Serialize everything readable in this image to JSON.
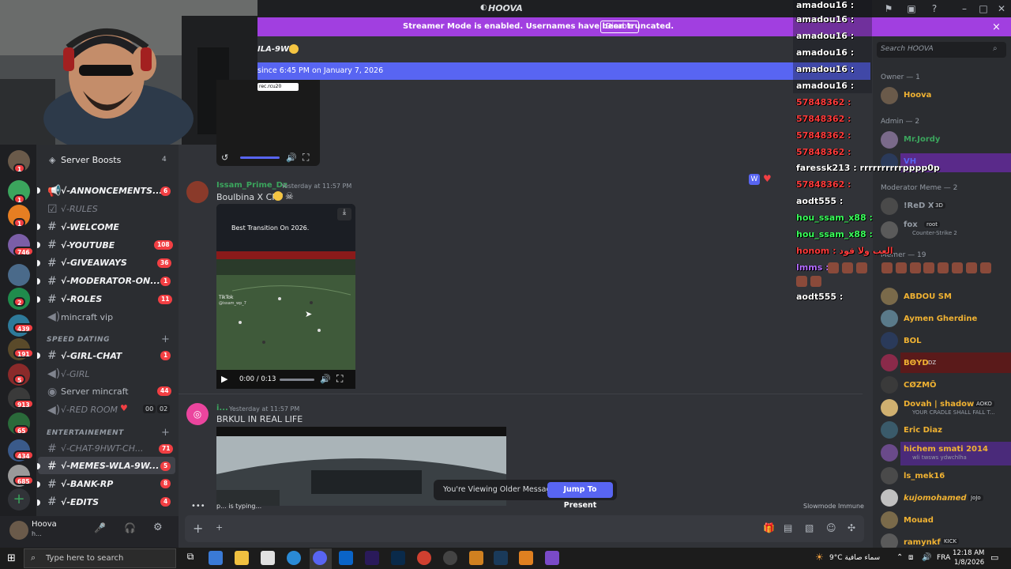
{
  "window": {
    "title": "HOOVA"
  },
  "banner": {
    "text": "Streamer Mode is enabled. Usernames have been truncated.",
    "disable_label": "Disable",
    "close": "×"
  },
  "channel_header": {
    "name_fragment": "ILA-9WD",
    "unread_bar": "since 6:45 PM on January 7, 2026"
  },
  "sidebar": {
    "server_boosts": {
      "label": "Server Boosts",
      "count": "4"
    },
    "channels": [
      {
        "icon": "#",
        "name": "√-ANNONCEMENTS...",
        "badge": "6"
      },
      {
        "icon": "#",
        "name": "√-RULES",
        "badge": ""
      },
      {
        "icon": "#",
        "name": "√-WELCOME",
        "badge": ""
      },
      {
        "icon": "#",
        "name": "√-YOUTUBE",
        "badge": "108"
      },
      {
        "icon": "#",
        "name": "√-GIVEAWAYS",
        "badge": "36"
      },
      {
        "icon": "#",
        "name": "√-MODERATOR-ON...",
        "badge": "1"
      },
      {
        "icon": "#",
        "name": "√-ROLES",
        "badge": "11"
      },
      {
        "icon": "🔊",
        "name": "mincraft vip",
        "badge": ""
      }
    ],
    "category_speed": "SPEED DATING",
    "speed_channels": [
      {
        "icon": "#",
        "name": "√-GIRL-CHAT",
        "badge": "1"
      },
      {
        "icon": "🔊",
        "name": "√-GIRL",
        "badge": ""
      },
      {
        "icon": "🔊",
        "name": "Server mincraft",
        "badge": "44"
      },
      {
        "icon": "🔊",
        "name": "√-RED ROOM",
        "badge": ""
      }
    ],
    "red_room_counts": [
      "00",
      "02"
    ],
    "category_ent": "ENTERTAINEMENT",
    "ent_channels": [
      {
        "icon": "#",
        "name": "√-CHAT-9HWT-CH...",
        "badge": "71"
      },
      {
        "icon": "#",
        "name": "√-MEMES-WLA-9W...",
        "badge": "5"
      },
      {
        "icon": "#",
        "name": "√-BANK-RP",
        "badge": "8"
      },
      {
        "icon": "#",
        "name": "√-EDITS",
        "badge": "4"
      }
    ]
  },
  "rail_badges": [
    "1",
    "1",
    "1",
    "746",
    "2",
    "439",
    "191",
    "5",
    "913",
    "65",
    "434",
    "685"
  ],
  "user_panel": {
    "name": "Hoova",
    "status": "h..."
  },
  "messages": [
    {
      "author": "Issam_Prime_Dz",
      "time": "Yesterday at 11:57 PM",
      "text": "Boulbina X CR7",
      "video_caption": "Best Transition On 2026.",
      "video_time": "0:00 / 0:13",
      "video_watermark": "TikTok",
      "video_handle": "@issam_wp_7"
    },
    {
      "author": "i...",
      "time": "Yesterday at 11:57 PM",
      "text": "BRKUL IN REAL LIFE"
    }
  ],
  "top_video_controls": {
    "label": "rec.rcu20"
  },
  "typing": {
    "text": "p... is typing...",
    "slowmode": "Slowmode Immune"
  },
  "older_bar": {
    "text": "You're Viewing Older Messages",
    "jump": "Jump To Present"
  },
  "composer": {
    "add": "+"
  },
  "overlay_chat": [
    {
      "user": "amadou16 :",
      "color": "#ffffff"
    },
    {
      "user": "amadou16 :",
      "color": "#ffffff"
    },
    {
      "user": "amadou16 :",
      "color": "#ffffff"
    },
    {
      "user": "amadou16 :",
      "color": "#ffffff"
    },
    {
      "user": "amadou16 :",
      "color": "#ffffff"
    },
    {
      "user": "amadou16 :",
      "color": "#ffffff"
    },
    {
      "user": "57848362 :",
      "color": "#ff3b3b"
    },
    {
      "user": "57848362 :",
      "color": "#ff3b3b"
    },
    {
      "user": "57848362 :",
      "color": "#ff3b3b"
    },
    {
      "user": "57848362 :",
      "color": "#ff3b3b"
    },
    {
      "user": "faressk213 : rrrrrrrrrrpppp0p",
      "color": "#ffffff"
    },
    {
      "user": "57848362 :",
      "color": "#ff3b3b"
    },
    {
      "user": "aodt555 :",
      "color": "#ffffff"
    },
    {
      "user": "hou_ssam_x88 :",
      "color": "#39ff5a"
    },
    {
      "user": "hou_ssam_x88 :",
      "color": "#39ff5a"
    },
    {
      "user": "honom : العب ولا قود",
      "color": "#ff3b3b"
    },
    {
      "user": "lmms :",
      "color": "#b36bff"
    },
    {
      "user": "aodt555 :",
      "color": "#ffffff"
    }
  ],
  "members": {
    "search_placeholder": "Search HOOVA",
    "owner_header": "Owner — 1",
    "owner": [
      {
        "name": "Hoova",
        "color": "#f0b232"
      }
    ],
    "admin_header": "Admin — 2",
    "admins": [
      {
        "name": "Mr.Jordy",
        "color": "#3ba55d"
      },
      {
        "name": "VH",
        "color": "#5865f2"
      }
    ],
    "mod_header": "Moderator Meme — 2",
    "mods": [
      {
        "name": "!ReD X",
        "tag": "3D",
        "sub": "",
        "color": "#949ba4"
      },
      {
        "name": "fox",
        "tag": "root",
        "sub": "Counter-Strike 2",
        "color": "#949ba4"
      }
    ],
    "member_header": "Memer — 19",
    "list": [
      {
        "name": "ABDOU SM",
        "tag": "",
        "sub": "",
        "color": "#f0b232"
      },
      {
        "name": "Aymen Gherdine",
        "tag": "",
        "sub": "",
        "color": "#f0b232"
      },
      {
        "name": "BOL",
        "tag": "",
        "sub": "",
        "color": "#f0b232"
      },
      {
        "name": "BΘYD",
        "tag": "DZ",
        "sub": "",
        "color": "#f0b232"
      },
      {
        "name": "CØZMÕ",
        "tag": "",
        "sub": "",
        "color": "#f0b232"
      },
      {
        "name": "Dovah | shadow...",
        "tag": "AOKO",
        "sub": "YOUR CRADLE SHALL FALL T...",
        "color": "#f0b232"
      },
      {
        "name": "Eric Diaz",
        "tag": "",
        "sub": "",
        "color": "#f0b232"
      },
      {
        "name": "hichem smati 2014",
        "tag": "",
        "sub": "wli twsws ydwchlha",
        "color": "#f0b232"
      },
      {
        "name": "ls_mek16",
        "tag": "",
        "sub": "",
        "color": "#f0b232"
      },
      {
        "name": "kujomohamed",
        "tag": "JoJo",
        "sub": "",
        "color": "#f0b232"
      },
      {
        "name": "Mouad",
        "tag": "",
        "sub": "",
        "color": "#f0b232"
      },
      {
        "name": "ramynkf",
        "tag": "KICK",
        "sub": "",
        "color": "#f0b232"
      }
    ]
  },
  "taskbar": {
    "search_placeholder": "Type here to search",
    "weather": "9°C  سماء صافية",
    "lang": "FRA",
    "time": "12:18 AM",
    "date": "1/8/2026"
  }
}
